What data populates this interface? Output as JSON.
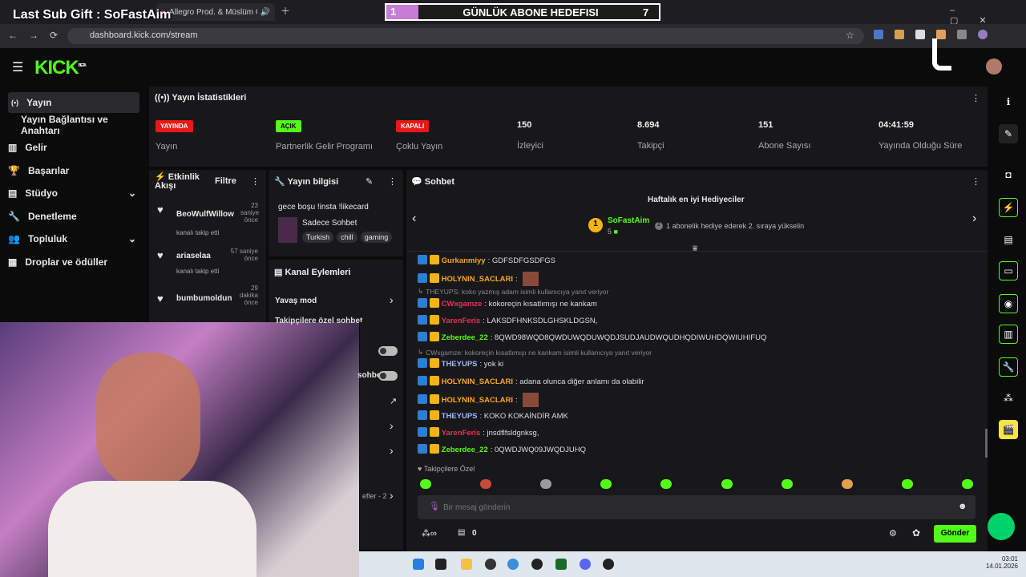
{
  "overlay": {
    "last_sub": "Last Sub Gift : SoFastAim",
    "goal_left": "1",
    "goal_title": "GÜNLÜK ABONE HEDEFISI",
    "goal_right": "7"
  },
  "browser": {
    "tab1": "Allegro Prod. & Müslüm Gürses",
    "url": "dashboard.kick.com/stream"
  },
  "logo": "KICK",
  "logo_beta": "BETA",
  "sidebar": {
    "items": [
      {
        "label": "Yayın",
        "icon": "broadcast-icon"
      },
      {
        "label": "Yayın Bağlantısı ve Anahtarı",
        "icon": ""
      },
      {
        "label": "Gelir",
        "icon": "bar-chart-icon"
      },
      {
        "label": "Başarılar",
        "icon": "trophy-icon"
      },
      {
        "label": "Stüdyo",
        "icon": "studio-icon"
      },
      {
        "label": "Denetleme",
        "icon": "wrench-icon"
      },
      {
        "label": "Topluluk",
        "icon": "community-icon"
      },
      {
        "label": "Droplar ve ödüller",
        "icon": "drops-icon"
      }
    ]
  },
  "stats": {
    "title": "Yayın İstatistikleri",
    "items": [
      {
        "badge": "YAYINDA",
        "label": "Yayın"
      },
      {
        "badge": "AÇIK",
        "label": "Partnerlik Gelir Programı"
      },
      {
        "badge": "KAPALI",
        "label": "Çoklu Yayın"
      },
      {
        "value": "150",
        "label": "İzleyici"
      },
      {
        "value": "8.694",
        "label": "Takipçi"
      },
      {
        "value": "151",
        "label": "Abone Sayısı"
      },
      {
        "value": "04:41:59",
        "label": "Yayında Olduğu Süre"
      }
    ]
  },
  "activity": {
    "title": "Etkinlik Akışı",
    "filter": "Filtre",
    "events": [
      {
        "name": "BeoWulfWillow",
        "time": "23 saniye önce",
        "desc": "kanalı takip etti"
      },
      {
        "name": "ariaselaa",
        "time": "57 saniye önce",
        "desc": "kanalı takip etti"
      },
      {
        "name": "bumbumoldun",
        "time": "29 dakika önce",
        "desc": "kanalı takip etti"
      }
    ]
  },
  "stream_info": {
    "title": "Yayın bilgisi",
    "stream_title": "gece boşu !insta !likecard",
    "category": "Sadece Sohbet",
    "tags": [
      "Turkish",
      "chill",
      "gaming"
    ]
  },
  "channel_actions": {
    "title": "Kanal Eylemleri",
    "slow_mode": "Yavaş mod",
    "followers_only": "Takipçilere özel sohbet",
    "sub_only": "sohbet",
    "partial": "efler - 2"
  },
  "chat": {
    "title": "Sohbet",
    "gifters_title": "Haftalık en iyi Hediyeciler",
    "top_gifter": "SoFastAim",
    "top_count": "5",
    "top_rank": "1",
    "rank_hint": "1 abonelik hediye ederek 2. sıraya yükselin",
    "rank_hint_num": "2",
    "messages": [
      {
        "user": "Gurkanmiyy",
        "color": "#f5a623",
        "text": ": GDFSDFGSDFGS"
      },
      {
        "user": "HOLYNIN_SACLARI",
        "color": "#f5a623",
        "text": ":"
      },
      {
        "reply": "THEYUPS: koko yazmış adam isimli kullanıcıya yanıt veriyor"
      },
      {
        "user": "CWxgamze",
        "color": "#e8305a",
        "text": ": kokoreçin kısatlımışı ne kankam"
      },
      {
        "user": "YarenFeris",
        "color": "#e8305a",
        "text": ": LAKSDFHNKSDLGHSKLDGSN,"
      },
      {
        "user": "Zeberdee_22",
        "color": "#53fc18",
        "text": ": 8QWD98WQD8QWDUWQDUWQDJSUDJAUDWQUDHQDIWUHDQWIUHIFUQ"
      },
      {
        "reply": "CWxgamze: kokoreçin kısatlımışı ne kankam isimli kullanıcıya yanıt veriyor"
      },
      {
        "user": "THEYUPS",
        "color": "#9ab8ff",
        "text": ": yok ki"
      },
      {
        "user": "HOLYNIN_SACLARI",
        "color": "#f5a623",
        "text": ": adana olunca diğer anlamı da olabilir"
      },
      {
        "user": "HOLYNIN_SACLARI",
        "color": "#f5a623",
        "text": ":"
      },
      {
        "user": "THEYUPS",
        "color": "#9ab8ff",
        "text": ": KOKO KOKAİNDİR AMK"
      },
      {
        "user": "YarenFeris",
        "color": "#e8305a",
        "text": ": jnsdflfsldgnksg,"
      },
      {
        "user": "Zeberdee_22",
        "color": "#53fc18",
        "text": ": 0QWDJWQ09JWQDJUHQ"
      }
    ],
    "followers_only": "Takipçilere Özel",
    "placeholder": "Bir mesaj gönderin",
    "points_value": "0",
    "send": "Gönder"
  },
  "taskbar": {
    "time": "03:01",
    "date": "14.01.2026"
  },
  "colors": {
    "accent": "#53fc18",
    "live": "#e91916",
    "panel": "#18181b"
  }
}
